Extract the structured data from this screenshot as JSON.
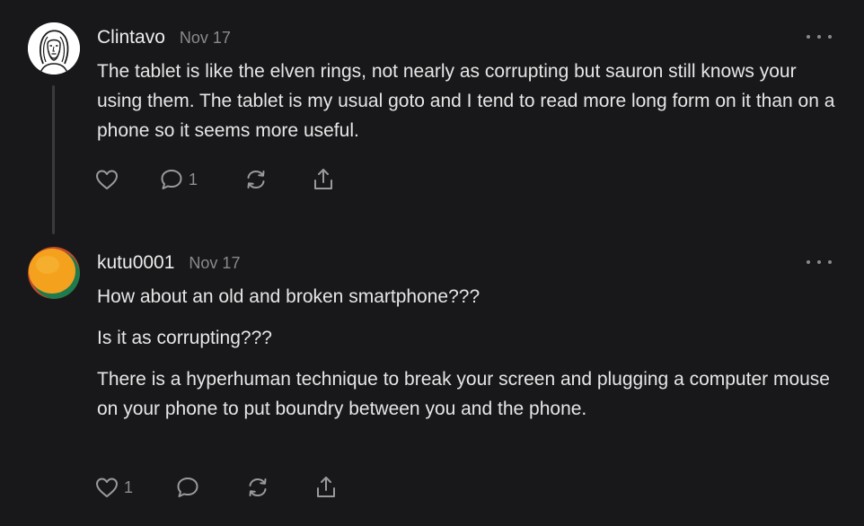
{
  "colors": {
    "background": "#18181a",
    "text": "#e6e6e6",
    "muted": "#8a8a8e",
    "thread_line": "#3a3a3c",
    "avatar2_orange": "#f4a21e",
    "avatar2_green": "#1f7a4d",
    "avatar2_red": "#c84a2a"
  },
  "comments": [
    {
      "author": "Clintavo",
      "date": "Nov 17",
      "avatar": "line-drawing-portrait",
      "paragraphs": [
        "The tablet is like the elven rings, not nearly as corrupting but sauron still knows your using them. The tablet is my usual goto and I tend to read more long form on it than on a phone so it seems more useful."
      ],
      "actions": {
        "like_count": "",
        "reply_count": "1",
        "icons": [
          "heart-icon",
          "comment-icon",
          "restack-icon",
          "share-icon"
        ]
      }
    },
    {
      "author": "kutu0001",
      "date": "Nov 17",
      "avatar": "orange-green-gradient-circle",
      "paragraphs": [
        "How about an old and broken smartphone???",
        "Is it as corrupting???",
        "There is a hyperhuman technique to break your screen and plugging a computer mouse on your phone to put boundry between you and the phone."
      ],
      "actions": {
        "like_count": "1",
        "reply_count": "",
        "icons": [
          "heart-icon",
          "comment-icon",
          "restack-icon",
          "share-icon"
        ]
      }
    }
  ]
}
